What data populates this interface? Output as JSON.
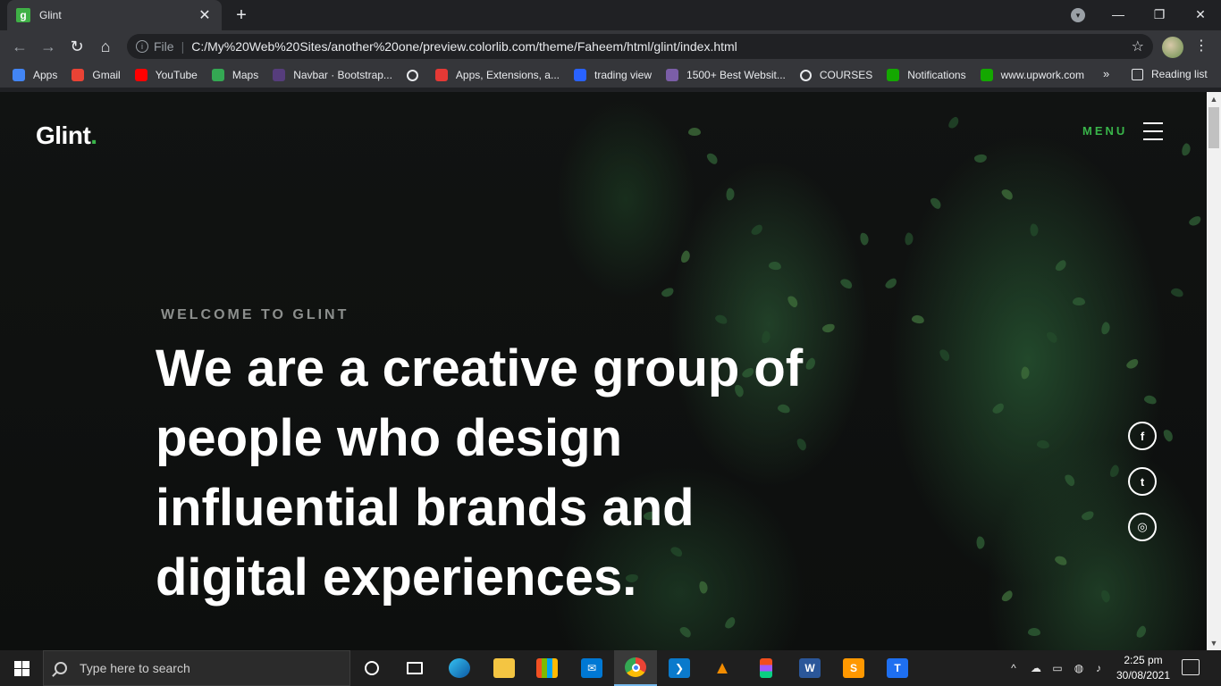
{
  "browser": {
    "tab_title": "Glint",
    "tab_favicon_letter": "g",
    "new_tab_label": "+",
    "close_tab_glyph": "✕",
    "file_label": "File",
    "url": "C:/My%20Web%20Sites/another%20one/preview.colorlib.com/theme/Faheem/html/glint/index.html",
    "bookmarks": [
      {
        "label": "Apps",
        "icon": "apps-grid-icon",
        "color": "#4285f4"
      },
      {
        "label": "Gmail",
        "icon": "gmail-icon",
        "color": "#ea4335"
      },
      {
        "label": "YouTube",
        "icon": "youtube-icon",
        "color": "#ff0000"
      },
      {
        "label": "Maps",
        "icon": "maps-icon",
        "color": "#34a853"
      },
      {
        "label": "Navbar · Bootstrap...",
        "icon": "bootstrap-icon",
        "color": "#563d7c"
      },
      {
        "label": "",
        "icon": "globe-icon",
        "color": "#e8eaed"
      },
      {
        "label": "Apps, Extensions, a...",
        "icon": "extensions-icon",
        "color": "#e53935"
      },
      {
        "label": "trading view",
        "icon": "tradingview-icon",
        "color": "#2962ff"
      },
      {
        "label": "1500+ Best Websit...",
        "icon": "colorlib-icon",
        "color": "#7b5ea7"
      },
      {
        "label": "COURSES",
        "icon": "globe-icon",
        "color": "#e8eaed"
      },
      {
        "label": "Notifications",
        "icon": "upwork-icon",
        "color": "#14a800"
      },
      {
        "label": "www.upwork.com",
        "icon": "upwork-icon",
        "color": "#14a800"
      }
    ],
    "bookmarks_more": "»",
    "reading_list": "Reading list"
  },
  "site": {
    "logo_text": "Glint",
    "logo_dot": ".",
    "menu_label": "MENU",
    "welcome": "WELCOME TO GLINT",
    "headline": "We are a creative group of people who design influential brands and digital experiences.",
    "social": [
      {
        "name": "facebook",
        "glyph": "f"
      },
      {
        "name": "twitter",
        "glyph": "t"
      },
      {
        "name": "instagram",
        "glyph": "◎"
      }
    ],
    "accent_color": "#39b54a"
  },
  "taskbar": {
    "search_placeholder": "Type here to search",
    "apps": [
      "cortana",
      "task-view",
      "edge",
      "file-explorer",
      "microsoft-store",
      "mail",
      "chrome",
      "vscode",
      "vlc",
      "figma",
      "word",
      "sublime-text",
      "typora"
    ],
    "time": "2:25 pm",
    "date": "30/08/2021"
  }
}
